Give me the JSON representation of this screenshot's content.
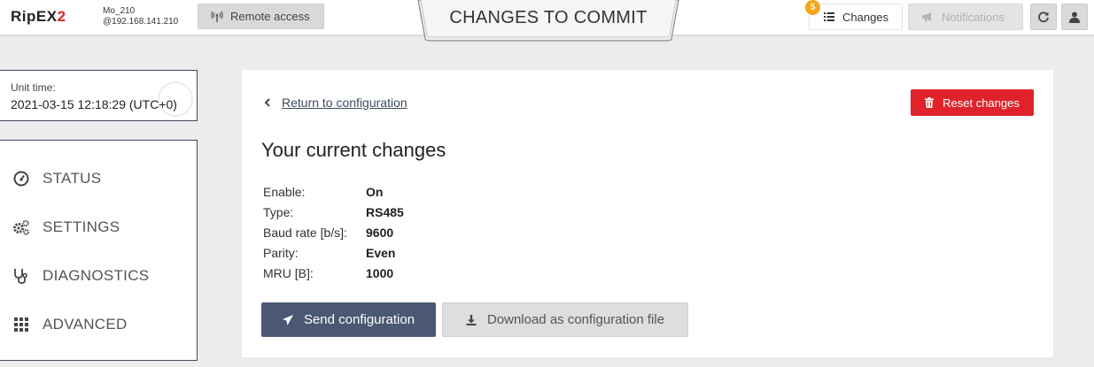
{
  "header": {
    "logo_text": "RipEX",
    "logo_suffix": "2",
    "unit_name": "Mo_210",
    "unit_address": "@192.168.141.210",
    "remote_access_label": "Remote access",
    "page_title": "CHANGES TO COMMIT",
    "changes_label": "Changes",
    "changes_count": "5",
    "notifications_label": "Notifications",
    "accent_color": "#e0232a",
    "badge_color": "#f2a619"
  },
  "unit_time": {
    "label": "Unit time:",
    "value": "2021-03-15 12:18:29 (UTC+0)"
  },
  "nav": {
    "items": [
      {
        "label": "STATUS",
        "icon": "gauge-icon"
      },
      {
        "label": "SETTINGS",
        "icon": "gears-icon"
      },
      {
        "label": "DIAGNOSTICS",
        "icon": "stethoscope-icon"
      },
      {
        "label": "ADVANCED",
        "icon": "grid-icon"
      }
    ]
  },
  "main": {
    "return_label": "Return to configuration",
    "reset_label": "Reset changes",
    "heading": "Your current changes",
    "changes": [
      {
        "key": "Enable:",
        "value": "On"
      },
      {
        "key": "Type:",
        "value": "RS485"
      },
      {
        "key": "Baud rate [b/s]:",
        "value": "9600"
      },
      {
        "key": "Parity:",
        "value": "Even"
      },
      {
        "key": "MRU [B]:",
        "value": "1000"
      }
    ],
    "send_label": "Send configuration",
    "download_label": "Download as configuration file",
    "send_color": "#4a5873"
  }
}
